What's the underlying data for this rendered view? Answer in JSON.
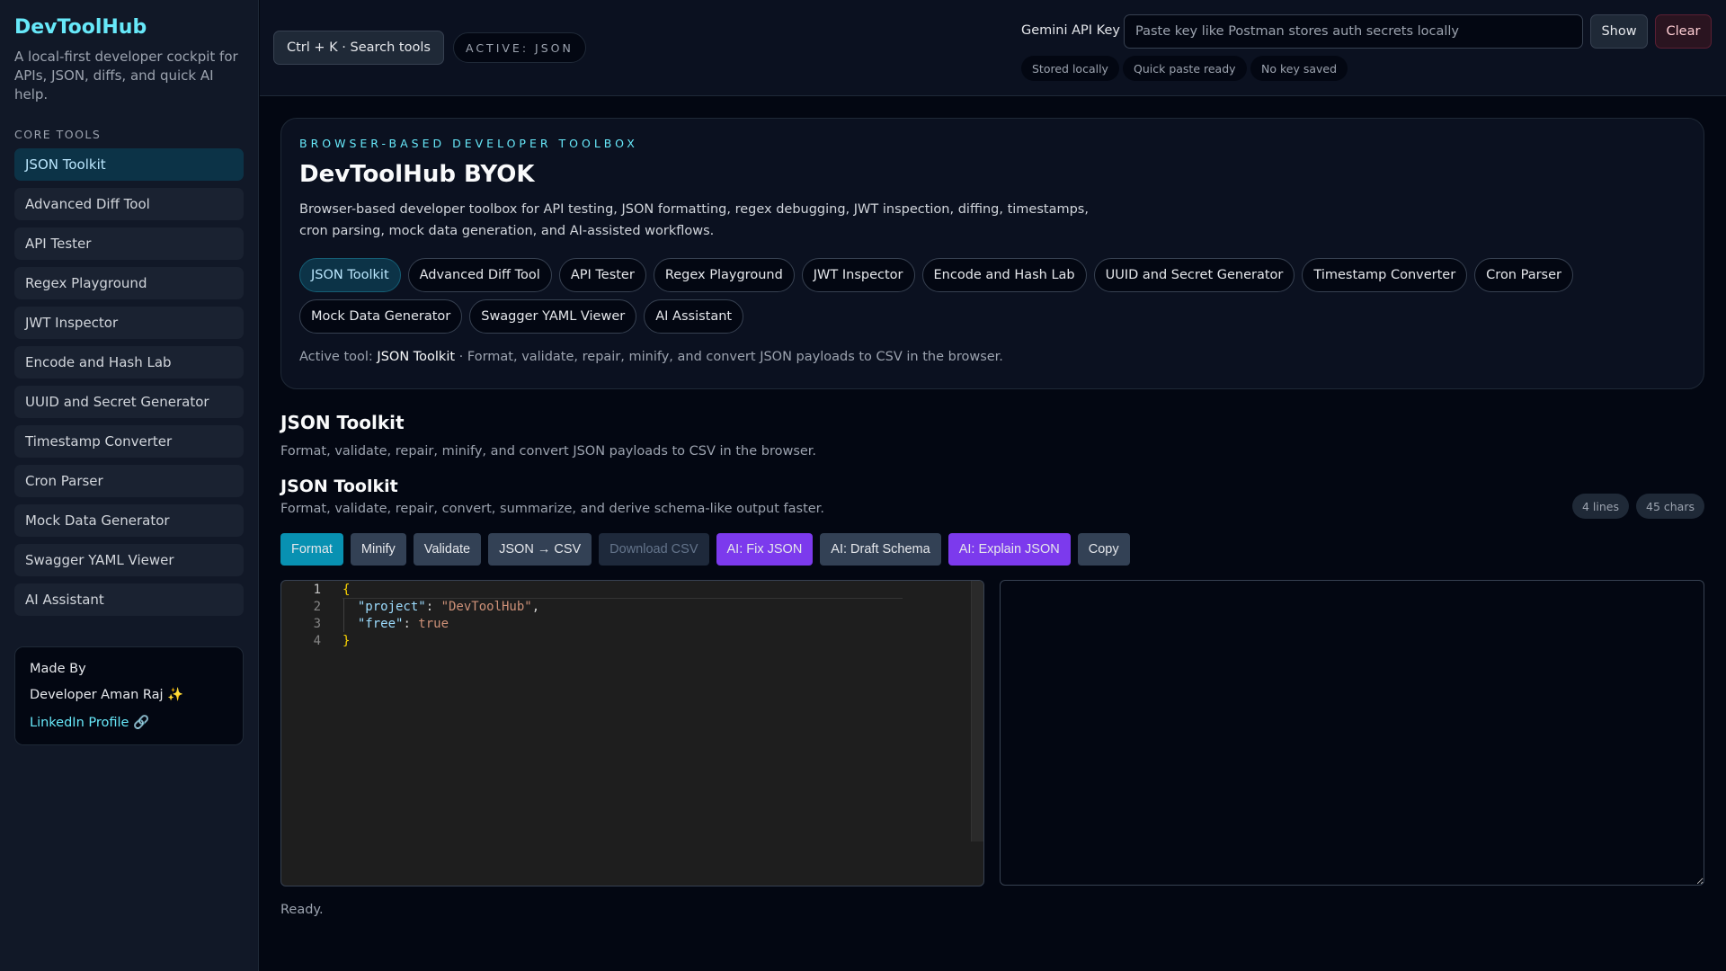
{
  "sidebar": {
    "brand": "DevToolHub",
    "tagline": "A local-first developer cockpit for APIs, JSON, diffs, and quick AI help.",
    "section": "CORE TOOLS",
    "items": [
      "JSON Toolkit",
      "Advanced Diff Tool",
      "API Tester",
      "Regex Playground",
      "JWT Inspector",
      "Encode and Hash Lab",
      "UUID and Secret Generator",
      "Timestamp Converter",
      "Cron Parser",
      "Mock Data Generator",
      "Swagger YAML Viewer",
      "AI Assistant"
    ],
    "credit": {
      "title": "Made By",
      "name": "Developer Aman Raj ✨",
      "link": "LinkedIn Profile 🔗"
    }
  },
  "header": {
    "search": "Ctrl + K · Search tools",
    "active": "ACTIVE: JSON",
    "key_label": "Gemini API Key",
    "key_placeholder": "Paste key like Postman stores auth secrets locally",
    "show": "Show",
    "clear": "Clear",
    "chips": [
      "Stored locally",
      "Quick paste ready",
      "No key saved"
    ]
  },
  "hero": {
    "eyebrow": "BROWSER-BASED DEVELOPER TOOLBOX",
    "title": "DevToolHub BYOK",
    "description": "Browser-based developer toolbox for API testing, JSON formatting, regex debugging, JWT inspection, diffing, timestamps, cron parsing, mock data generation, and AI-assisted workflows.",
    "pills": [
      "JSON Toolkit",
      "Advanced Diff Tool",
      "API Tester",
      "Regex Playground",
      "JWT Inspector",
      "Encode and Hash Lab",
      "UUID and Secret Generator",
      "Timestamp Converter",
      "Cron Parser",
      "Mock Data Generator",
      "Swagger YAML Viewer",
      "AI Assistant"
    ],
    "active_prefix": "Active tool:",
    "active_name": "JSON Toolkit",
    "active_desc": " · Format, validate, repair, minify, and convert JSON payloads to CSV in the browser."
  },
  "tool": {
    "title": "JSON Toolkit",
    "subtitle": "Format, validate, repair, minify, and convert JSON payloads to CSV in the browser.",
    "panel_title": "JSON Toolkit",
    "panel_subtitle": "Format, validate, repair, convert, summarize, and derive schema-like output faster.",
    "lines": "4 lines",
    "chars": "45 chars",
    "buttons": [
      "Format",
      "Minify",
      "Validate",
      "JSON → CSV",
      "Download CSV",
      "AI: Fix JSON",
      "AI: Draft Schema",
      "AI: Explain JSON",
      "Copy"
    ],
    "editor": {
      "line_numbers": [
        "1",
        "2",
        "3",
        "4"
      ],
      "open": "{",
      "k1": "\"project\"",
      "v1": "\"DevToolHub\"",
      "k2": "\"free\"",
      "v2": "true",
      "close": "}",
      "colon": ": ",
      "comma": ","
    },
    "status": "Ready."
  }
}
